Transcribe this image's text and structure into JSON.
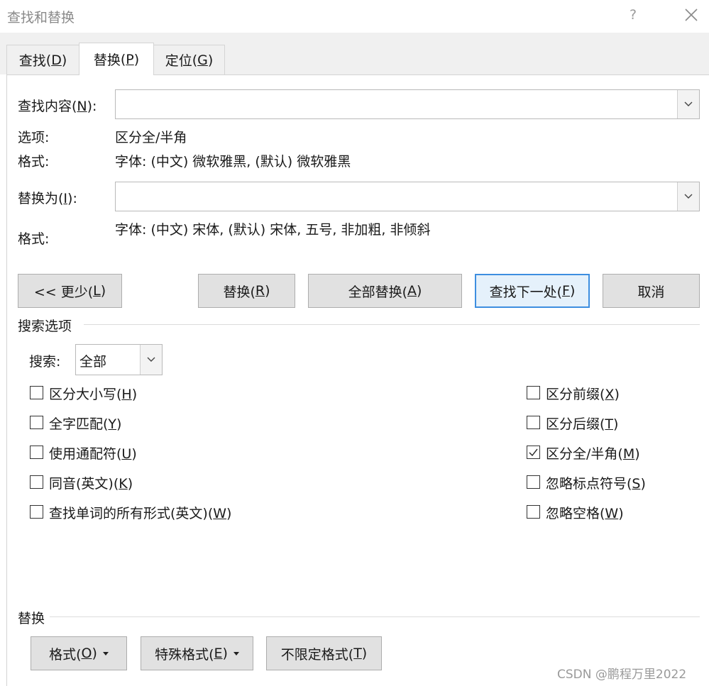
{
  "window": {
    "title": "查找和替换",
    "help": "?"
  },
  "tabs": [
    {
      "label": "查找",
      "key": "(D)",
      "keychar": "D"
    },
    {
      "label": "替换",
      "key": "(P)",
      "keychar": "P"
    },
    {
      "label": "定位",
      "key": "(G)",
      "keychar": "G"
    }
  ],
  "find": {
    "label_pre": "查找内容(",
    "label_key": "N",
    "label_post": "):",
    "value": "",
    "options_label": "选项:",
    "options_value": "区分全/半角",
    "format_label": "格式:",
    "format_value": "字体: (中文) 微软雅黑, (默认) 微软雅黑"
  },
  "replace": {
    "label_pre": "替换为(",
    "label_key": "I",
    "label_post": "):",
    "value": "",
    "format_label": "格式:",
    "format_value": "字体: (中文) 宋体, (默认) 宋体, 五号, 非加粗, 非倾斜"
  },
  "buttons": {
    "less": {
      "pre": "<< 更少(",
      "key": "L",
      "post": ")"
    },
    "replace": {
      "pre": "替换(",
      "key": "R",
      "post": ")"
    },
    "replace_all": {
      "pre": "全部替换(",
      "key": "A",
      "post": ")"
    },
    "find_next": {
      "pre": "查找下一处(",
      "key": "F",
      "post": ")"
    },
    "cancel": "取消"
  },
  "search_options": {
    "title": "搜索选项",
    "search_label": "搜索:",
    "search_value": "全部",
    "left": [
      {
        "pre": "区分大小写(",
        "key": "H",
        "post": ")",
        "checked": false
      },
      {
        "pre": "全字匹配(",
        "key": "Y",
        "post": ")",
        "checked": false
      },
      {
        "pre": "使用通配符(",
        "key": "U",
        "post": ")",
        "checked": false
      },
      {
        "pre": "同音(英文)(",
        "key": "K",
        "post": ")",
        "checked": false
      },
      {
        "pre": "查找单词的所有形式(英文)(",
        "key": "W",
        "post": ")",
        "checked": false
      }
    ],
    "right": [
      {
        "pre": "区分前缀(",
        "key": "X",
        "post": ")",
        "checked": false
      },
      {
        "pre": "区分后缀(",
        "key": "T",
        "post": ")",
        "checked": false
      },
      {
        "pre": "区分全/半角(",
        "key": "M",
        "post": ")",
        "checked": true
      },
      {
        "pre": "忽略标点符号(",
        "key": "S",
        "post": ")",
        "checked": false
      },
      {
        "pre": "忽略空格(",
        "key": "W",
        "post": ")",
        "checked": false
      }
    ]
  },
  "replace_section": {
    "title": "替换",
    "format": {
      "pre": "格式(",
      "key": "O",
      "post": ")"
    },
    "special": {
      "pre": "特殊格式(",
      "key": "E",
      "post": ")"
    },
    "no_format": {
      "pre": "不限定格式(",
      "key": "T",
      "post": ")"
    }
  },
  "watermark": "CSDN @鹏程万里2022"
}
